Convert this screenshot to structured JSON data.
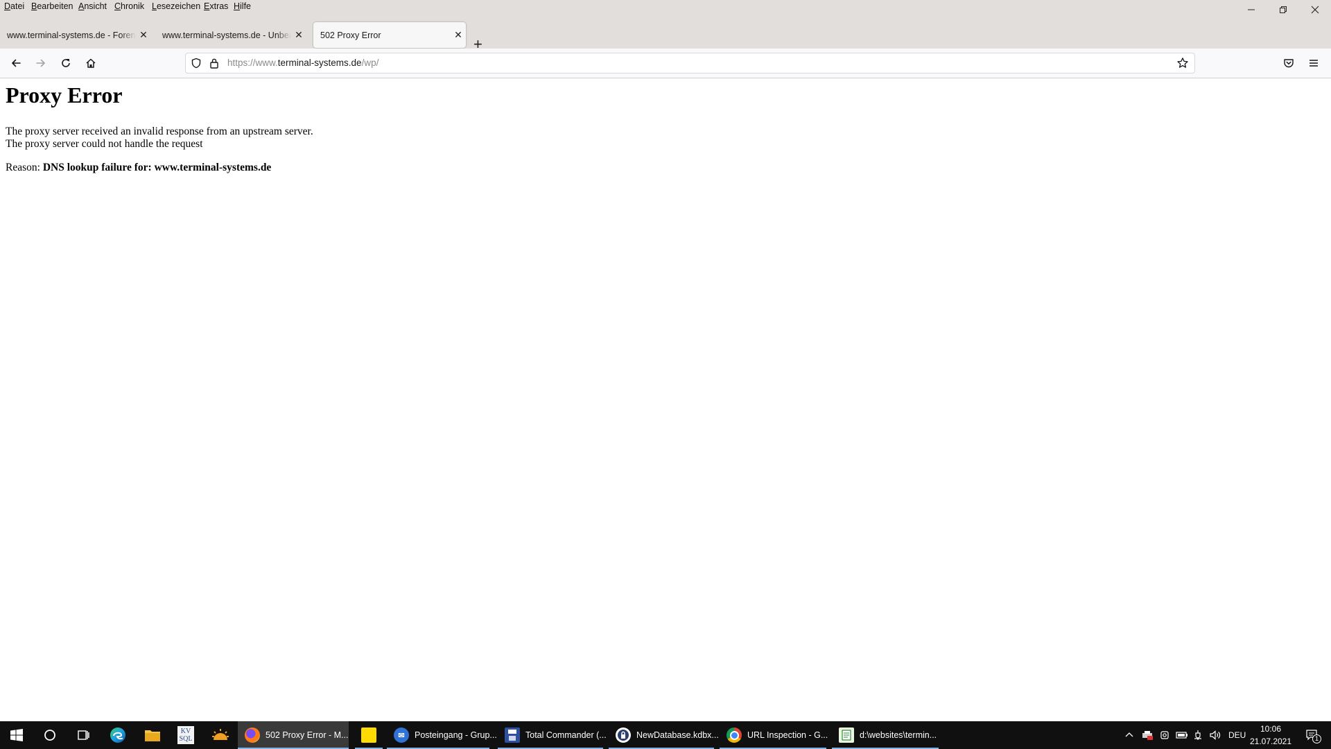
{
  "menubar": {
    "items": [
      {
        "first": "D",
        "rest": "atei"
      },
      {
        "first": "B",
        "rest": "earbeiten"
      },
      {
        "first": "A",
        "rest": "nsicht"
      },
      {
        "first": "C",
        "rest": "hronik"
      },
      {
        "first": "L",
        "rest": "esezeichen"
      },
      {
        "first": "E",
        "rest": "xtras"
      },
      {
        "first": "H",
        "rest": "ilfe"
      }
    ]
  },
  "tabs": [
    {
      "label": "www.terminal-systems.de - Foren-Übersicht",
      "active": false
    },
    {
      "label": "www.terminal-systems.de - Unbeantwortete Themen",
      "active": false
    },
    {
      "label": "502 Proxy Error",
      "active": true
    }
  ],
  "url": {
    "scheme": "https://www.",
    "host": "terminal-systems.de",
    "path": "/wp/"
  },
  "page": {
    "title": "Proxy Error",
    "line1": "The proxy server received an invalid response from an upstream server.",
    "line2": "The proxy server could not handle the request",
    "reason_label": "Reason: ",
    "reason_value": "DNS lookup failure for: www.terminal-systems.de"
  },
  "taskbar": {
    "apps": [
      {
        "label": "502 Proxy Error - M...",
        "icon": "firefox-icon",
        "active": true
      },
      {
        "label": "",
        "icon": "sticky-notes-icon",
        "active": false
      },
      {
        "label": "Posteingang - Grup...",
        "icon": "thunderbird-icon",
        "active": false
      },
      {
        "label": "Total Commander (...",
        "icon": "floppy-disk-icon",
        "active": false
      },
      {
        "label": "NewDatabase.kdbx...",
        "icon": "keepass-icon",
        "active": false
      },
      {
        "label": "URL Inspection - G...",
        "icon": "chrome-icon",
        "active": false
      },
      {
        "label": "d:\\websites\\termin...",
        "icon": "notepad-icon",
        "active": false
      }
    ],
    "pinned_kv_label": "KV\nSQL",
    "language": "DEU",
    "time": "10:06",
    "date": "21.07.2021",
    "notification_count": "1"
  },
  "colors": {
    "chrome_bg": "#e1dedb",
    "taskbar_bg": "#101010",
    "accent": "#7fb4e6"
  }
}
